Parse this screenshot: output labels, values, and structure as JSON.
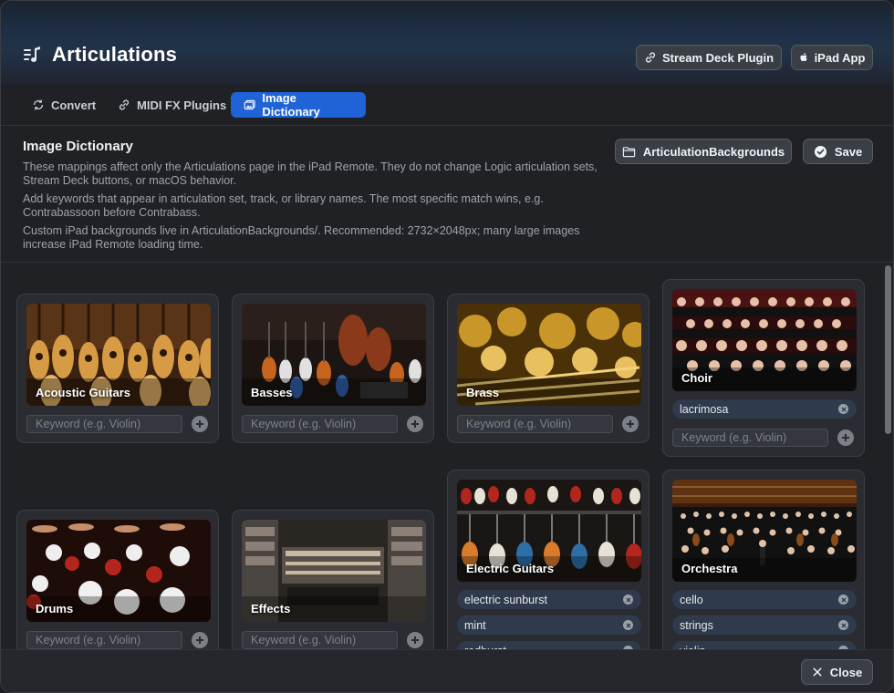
{
  "app": {
    "title": "Articulations",
    "icon": "music-list-icon"
  },
  "header_buttons": {
    "stream_deck": {
      "label": "Stream Deck Plugin",
      "icon": "link-icon"
    },
    "ipad_app": {
      "label": "iPad App",
      "icon": "apple-icon"
    }
  },
  "tabs": [
    {
      "label": "Convert",
      "icon": "refresh-icon",
      "active": false
    },
    {
      "label": "MIDI FX Plugins",
      "icon": "link-icon",
      "active": false
    },
    {
      "label": "Image Dictionary",
      "icon": "photos-icon",
      "active": true
    }
  ],
  "intro": {
    "title": "Image Dictionary",
    "p1": "These mappings affect only the Articulations page in the iPad Remote. They do not change Logic articulation sets, Stream Deck buttons, or macOS behavior.",
    "p2": "Add keywords that appear in articulation set, track, or library names. The most specific match wins, e.g. Contrabassoon before Contrabass.",
    "p3": "Custom iPad backgrounds live in ArticulationBackgrounds/. Recommended: 2732×2048px; many large images increase iPad Remote loading time."
  },
  "actions": {
    "folder": {
      "label": "ArticulationBackgrounds",
      "icon": "folder-icon"
    },
    "save": {
      "label": "Save",
      "icon": "checkmark-circle-icon"
    }
  },
  "keyword_placeholder": "Keyword (e.g. Violin)",
  "cards": [
    {
      "name": "Acoustic Guitars",
      "tags": []
    },
    {
      "name": "Basses",
      "tags": []
    },
    {
      "name": "Brass",
      "tags": []
    },
    {
      "name": "Choir",
      "tags": [
        "lacrimosa"
      ]
    },
    {
      "name": "Drums",
      "tags": []
    },
    {
      "name": "Effects",
      "tags": []
    },
    {
      "name": "Electric Guitars",
      "tags": [
        "electric sunburst",
        "mint",
        "redburst"
      ]
    },
    {
      "name": "Orchestra",
      "tags": [
        "cello",
        "strings",
        "violin"
      ]
    }
  ],
  "footer": {
    "close": {
      "label": "Close",
      "icon": "close-icon"
    }
  },
  "colors": {
    "accent": "#1f63d6",
    "tag_bg": "#2f3b4d",
    "card_bg": "#2a2c31",
    "window_bg": "#1f2125"
  }
}
